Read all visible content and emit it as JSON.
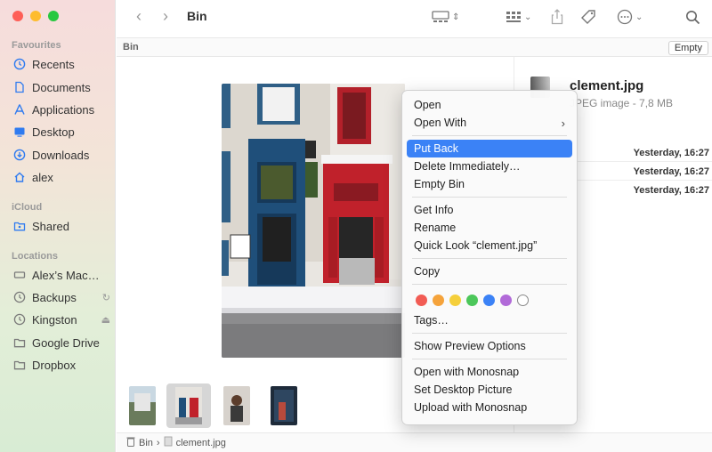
{
  "window": {
    "title": "Bin"
  },
  "sidebar": {
    "favourites_label": "Favourites",
    "favourites": [
      {
        "label": "Recents",
        "icon": "clock-icon"
      },
      {
        "label": "Documents",
        "icon": "document-icon"
      },
      {
        "label": "Applications",
        "icon": "applications-icon"
      },
      {
        "label": "Desktop",
        "icon": "desktop-icon"
      },
      {
        "label": "Downloads",
        "icon": "downloads-icon"
      },
      {
        "label": "alex",
        "icon": "home-icon"
      }
    ],
    "icloud_label": "iCloud",
    "icloud": [
      {
        "label": "Shared",
        "icon": "shared-folder-icon"
      }
    ],
    "locations_label": "Locations",
    "locations": [
      {
        "label": "Alex’s Mac…",
        "icon": "computer-icon"
      },
      {
        "label": "Backups",
        "icon": "clock-icon",
        "trail_icon": "sync-icon"
      },
      {
        "label": "Kingston",
        "icon": "clock-icon",
        "trail_icon": "eject-icon"
      },
      {
        "label": "Google Drive",
        "icon": "folder-icon"
      },
      {
        "label": "Dropbox",
        "icon": "folder-icon"
      }
    ]
  },
  "toolbar": {
    "title": "Bin"
  },
  "pathbar": {
    "label": "Bin",
    "empty_button": "Empty"
  },
  "details": {
    "file_name": "clement.jpg",
    "file_meta": "JPEG image - 7,8 MB",
    "rows": [
      "Yesterday, 16:27",
      "Yesterday, 16:27",
      "Yesterday, 16:27"
    ]
  },
  "statusbar": {
    "bin": "Bin",
    "file": "clement.jpg"
  },
  "context_menu": {
    "group1": [
      {
        "label": "Open"
      },
      {
        "label": "Open With",
        "submenu": true
      }
    ],
    "group2": [
      {
        "label": "Put Back",
        "highlighted": true
      },
      {
        "label": "Delete Immediately…"
      },
      {
        "label": "Empty Bin"
      }
    ],
    "group3": [
      {
        "label": "Get Info"
      },
      {
        "label": "Rename"
      },
      {
        "label": "Quick Look “clement.jpg”"
      }
    ],
    "group4": [
      {
        "label": "Copy"
      }
    ],
    "tag_colors": [
      "#f25c54",
      "#f5a33b",
      "#f5cf3b",
      "#4cc75a",
      "#3b82f6",
      "#b16ad8"
    ],
    "tags_label": "Tags…",
    "group5": [
      {
        "label": "Show Preview Options"
      }
    ],
    "group6": [
      {
        "label": "Open with Monosnap"
      },
      {
        "label": "Set Desktop Picture"
      },
      {
        "label": "Upload with Monosnap"
      }
    ]
  }
}
